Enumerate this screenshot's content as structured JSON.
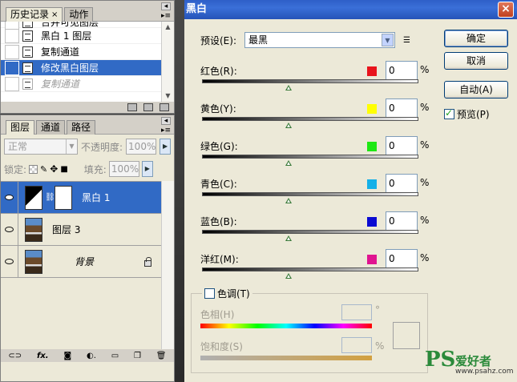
{
  "history": {
    "tabs": [
      {
        "label": "历史记录"
      },
      {
        "label": "动作"
      }
    ],
    "tab_close": "×",
    "items": [
      {
        "label": "合并可见图层"
      },
      {
        "label": "黑白 1 图层"
      },
      {
        "label": "复制通道"
      },
      {
        "label": "修改黑白图层"
      },
      {
        "label": "复制通道"
      }
    ]
  },
  "layers_panel": {
    "tabs": [
      {
        "label": "图层"
      },
      {
        "label": "通道"
      },
      {
        "label": "路径"
      }
    ],
    "blend_mode": "正常",
    "opacity_label": "不透明度:",
    "opacity_value": "100%",
    "lock_label": "锁定:",
    "fill_label": "填充:",
    "fill_value": "100%",
    "layers": [
      {
        "name": "黑白 1"
      },
      {
        "name": "图层 3"
      },
      {
        "name": "背景"
      }
    ],
    "footer_icons": [
      "link-icon",
      "fx-icon",
      "mask-icon",
      "adjustment-icon",
      "group-icon",
      "new-layer-icon",
      "trash-icon"
    ]
  },
  "dialog": {
    "title": "黑白",
    "close": "×",
    "preset_label": "预设(E):",
    "preset_value": "最黑",
    "ok": "确定",
    "cancel": "取消",
    "auto": "自动(A)",
    "preview_label": "预览(P)",
    "preview_checked": true,
    "percent": "%",
    "channels": [
      {
        "label": "红色(R):",
        "value": "0",
        "color": "#e8141c",
        "grad_from": "#000000",
        "grad_to": "#ffffff",
        "level": 0.4
      },
      {
        "label": "黄色(Y):",
        "value": "0",
        "color": "#ffff00",
        "grad_from": "#000000",
        "grad_to": "#ffffff",
        "level": 0.4
      },
      {
        "label": "绿色(G):",
        "value": "0",
        "color": "#1ee814",
        "grad_from": "#000000",
        "grad_to": "#ffffff",
        "level": 0.4
      },
      {
        "label": "青色(C):",
        "value": "0",
        "color": "#14b0e8",
        "grad_from": "#000000",
        "grad_to": "#ffffff",
        "level": 0.4
      },
      {
        "label": "蓝色(B):",
        "value": "0",
        "color": "#0a0ad2",
        "grad_from": "#000000",
        "grad_to": "#ffffff",
        "level": 0.4
      },
      {
        "label": "洋红(M):",
        "value": "0",
        "color": "#e01490",
        "grad_from": "#000000",
        "grad_to": "#ffffff",
        "level": 0.4
      }
    ],
    "tint": {
      "label": "色调(T)",
      "checked": false,
      "hue_label": "色相(H)",
      "hue_unit": "°",
      "saturation_label": "饱和度(S)",
      "saturation_unit": "%"
    }
  },
  "watermark": {
    "brand": "PS",
    "name": "爱好者",
    "url": "www.psahz.com"
  }
}
